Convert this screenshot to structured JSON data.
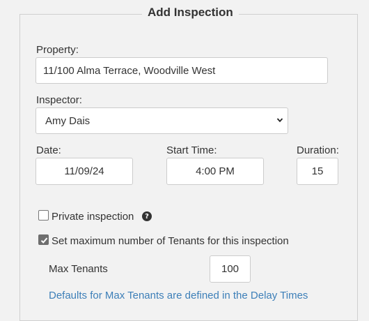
{
  "form": {
    "title": "Add Inspection",
    "property": {
      "label": "Property:",
      "value": "11/100 Alma Terrace, Woodville West"
    },
    "inspector": {
      "label": "Inspector:",
      "selected": "Amy Dais",
      "chevron_icon": "chevron-down-icon"
    },
    "date": {
      "label": "Date:",
      "value": "11/09/24"
    },
    "start_time": {
      "label": "Start Time:",
      "value": "4:00 PM"
    },
    "duration": {
      "label": "Duration:",
      "value": "15"
    },
    "private_inspection": {
      "label": "Private inspection",
      "checked": false,
      "help_icon": "question-circle-icon",
      "help_glyph": "?"
    },
    "max_tenants_toggle": {
      "label": "Set maximum number of Tenants for this inspection",
      "checked": true
    },
    "max_tenants": {
      "label": "Max Tenants",
      "value": "100"
    },
    "defaults_link": "Defaults for Max Tenants are defined in the Delay Times"
  },
  "colors": {
    "background": "#f2f2f2",
    "link": "#3d7fb8",
    "text": "#333333",
    "checkbox_checked": "#6e6e6e"
  }
}
